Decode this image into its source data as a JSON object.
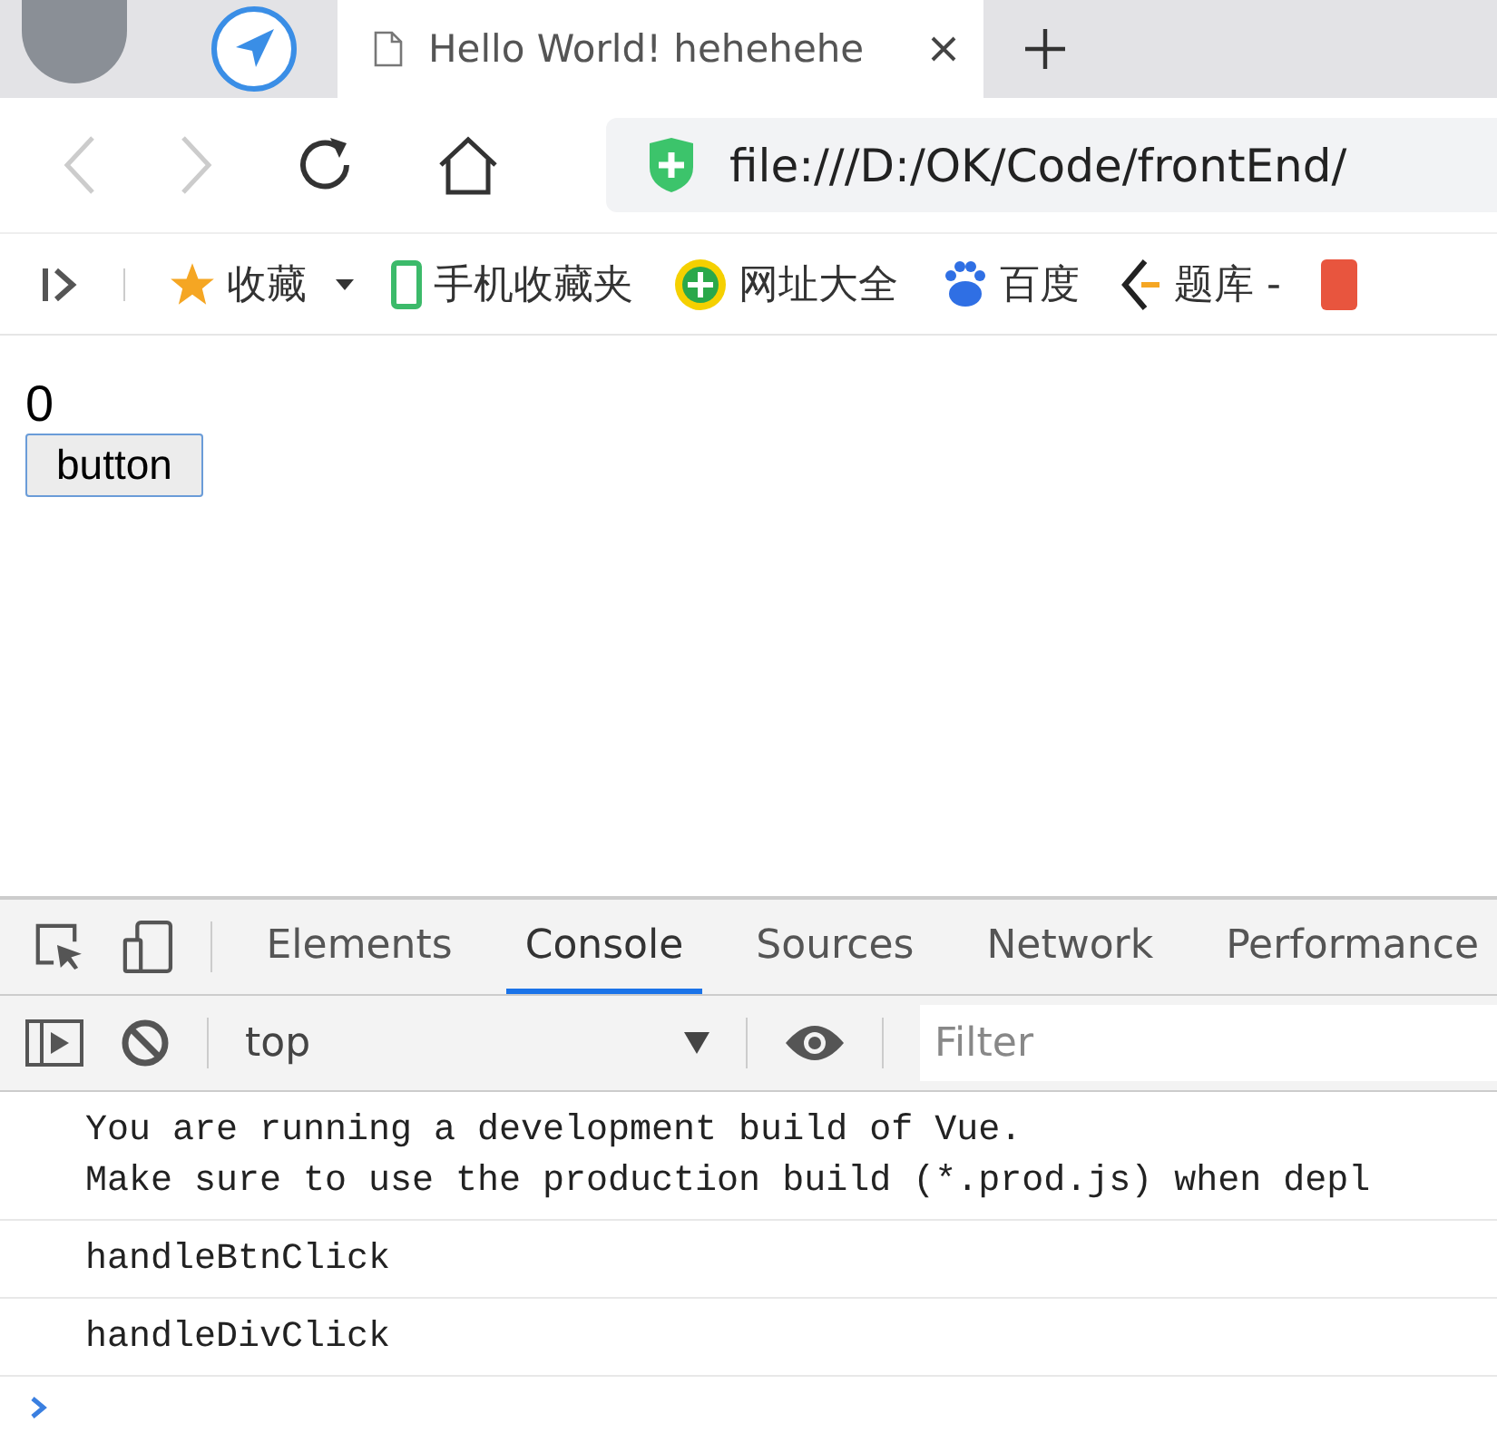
{
  "browser_tabs": [
    {
      "kind": "avatar"
    },
    {
      "kind": "app"
    },
    {
      "kind": "page",
      "title": "Hello World! hehehehe",
      "selected": true
    }
  ],
  "address": {
    "url": "file:///D:/OK/Code/frontEnd/"
  },
  "bookmarks": [
    {
      "kind": "star",
      "label": "收藏"
    },
    {
      "kind": "phone",
      "label": "手机收藏夹"
    },
    {
      "kind": "plus",
      "label": "网址大全"
    },
    {
      "kind": "paw",
      "label": "百度"
    },
    {
      "kind": "bracket",
      "label": "题库 -"
    }
  ],
  "page": {
    "counter": "0",
    "button": "button"
  },
  "devtools": {
    "tabs": [
      {
        "label": "Elements",
        "selected": false
      },
      {
        "label": "Console",
        "selected": true
      },
      {
        "label": "Sources",
        "selected": false
      },
      {
        "label": "Network",
        "selected": false
      },
      {
        "label": "Performance",
        "selected": false
      }
    ],
    "context": "top",
    "filter_placeholder": "Filter",
    "messages": [
      [
        "You are running a development build of Vue.",
        "Make sure to use the production build (*.prod.js) when depl"
      ],
      [
        "handleBtnClick"
      ],
      [
        "handleDivClick"
      ]
    ]
  }
}
